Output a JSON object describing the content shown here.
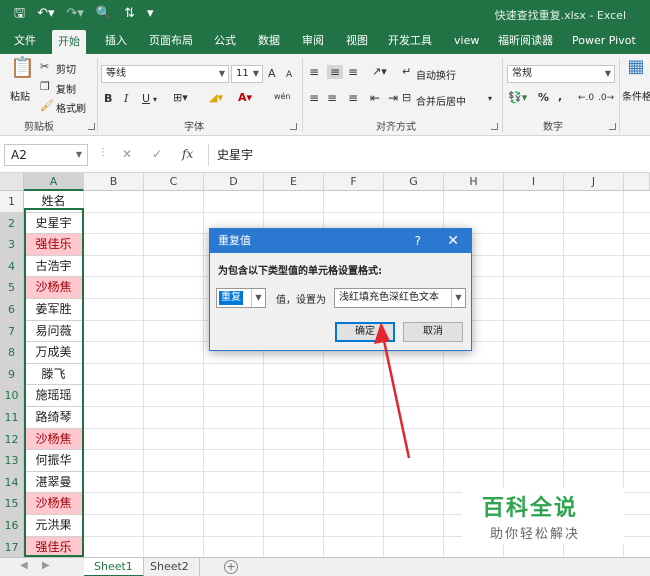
{
  "window": {
    "title": "快速查找重复.xlsx  -  Excel"
  },
  "qat": {
    "save_icon": "save-icon",
    "undo_icon": "undo-icon",
    "redo_icon": "redo-icon"
  },
  "tabs": [
    "文件",
    "开始",
    "插入",
    "页面布局",
    "公式",
    "数据",
    "审阅",
    "视图",
    "开发工具",
    "view",
    "福昕阅读器",
    "Power Pivot"
  ],
  "ribbon": {
    "clipboard": {
      "paste": "粘贴",
      "cut": "剪切",
      "copy": "复制",
      "format_painter": "格式刷",
      "label": "剪贴板"
    },
    "font": {
      "name": "等线",
      "size": "11",
      "bold": "B",
      "italic": "I",
      "underline": "U",
      "label": "字体",
      "grow": "A",
      "shrink": "A",
      "phonetic": "wén"
    },
    "alignment": {
      "wrap": "自动换行",
      "merge": "合并后居中",
      "label": "对齐方式"
    },
    "number": {
      "format": "常规",
      "percent": "%",
      "comma": ",",
      "label": "数字"
    },
    "styles": {
      "conditional": "条件格"
    }
  },
  "formula_bar": {
    "name_box": "A2",
    "fx": "fx",
    "value": "史星宇"
  },
  "columns": [
    "A",
    "B",
    "C",
    "D",
    "E",
    "F",
    "G",
    "H",
    "I",
    "J"
  ],
  "rows": [
    "1",
    "2",
    "3",
    "4",
    "5",
    "6",
    "7",
    "8",
    "9",
    "10",
    "11",
    "12",
    "13",
    "14",
    "15",
    "16",
    "17"
  ],
  "column_a": [
    {
      "text": "姓名",
      "dup": false
    },
    {
      "text": "史星宇",
      "dup": false
    },
    {
      "text": "强佳乐",
      "dup": true
    },
    {
      "text": "古浩宇",
      "dup": false
    },
    {
      "text": "沙杨焦",
      "dup": true
    },
    {
      "text": "姜军胜",
      "dup": false
    },
    {
      "text": "易问薇",
      "dup": false
    },
    {
      "text": "万成美",
      "dup": false
    },
    {
      "text": "滕飞",
      "dup": false
    },
    {
      "text": "施瑶瑶",
      "dup": false
    },
    {
      "text": "路绮琴",
      "dup": false
    },
    {
      "text": "沙杨焦",
      "dup": true
    },
    {
      "text": "何振华",
      "dup": false
    },
    {
      "text": "湛翠曼",
      "dup": false
    },
    {
      "text": "沙杨焦",
      "dup": true
    },
    {
      "text": "元洪果",
      "dup": false
    },
    {
      "text": "强佳乐",
      "dup": true
    }
  ],
  "sheets": [
    "Sheet1",
    "Sheet2"
  ],
  "dialog": {
    "title": "重复值",
    "help": "?",
    "prompt": "为包含以下类型值的单元格设置格式:",
    "value_type": "重复",
    "middle": "值，设置为",
    "format": "浅红填充色深红色文本",
    "ok": "确定",
    "cancel": "取消"
  },
  "watermark": {
    "main": "百科全说",
    "sub": "助你轻松解决"
  },
  "colors": {
    "excel_green": "#217346",
    "dialog_blue": "#2b78d0",
    "dup_fill": "#ffc7ce",
    "dup_text": "#9c0006",
    "arrow_red": "#e0262e"
  }
}
